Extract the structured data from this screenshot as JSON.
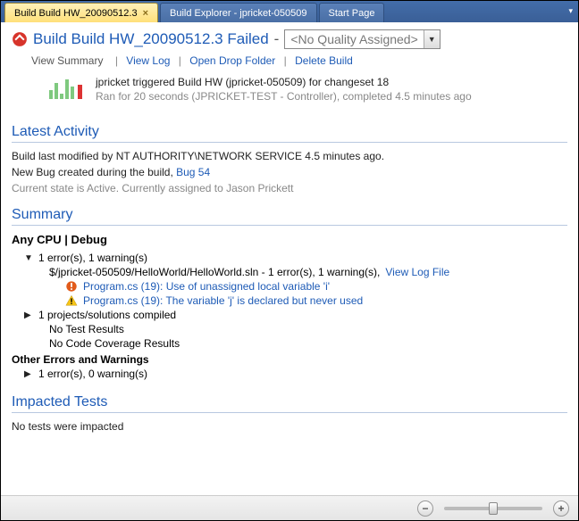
{
  "tabs": [
    {
      "label": "Build Build HW_20090512.3",
      "active": true
    },
    {
      "label": "Build Explorer - jpricket-050509",
      "active": false
    },
    {
      "label": "Start Page",
      "active": false
    }
  ],
  "header": {
    "title": "Build Build HW_20090512.3 Failed",
    "dash": " - ",
    "quality_placeholder": "<No Quality Assigned>"
  },
  "actions": {
    "view_summary": "View Summary",
    "view_log": "View Log",
    "open_drop": "Open Drop Folder",
    "delete_build": "Delete Build"
  },
  "trigger": {
    "line1": "jpricket triggered Build HW (jpricket-050509) for changeset 18",
    "line2": "Ran for 20 seconds (JPRICKET-TEST - Controller), completed 4.5 minutes ago"
  },
  "latest_activity": {
    "heading": "Latest Activity",
    "line1": "Build last modified by NT AUTHORITY\\NETWORK SERVICE 4.5 minutes ago.",
    "line2_pre": "New Bug created during the build, ",
    "bug_link": "Bug 54",
    "line3": "Current state is Active. Currently assigned to Jason Prickett"
  },
  "summary": {
    "heading": "Summary",
    "config": "Any CPU | Debug",
    "err_warn": "1 error(s), 1 warning(s)",
    "sln_path": "$/jpricket-050509/HelloWorld/HelloWorld.sln - 1 error(s), 1 warning(s), ",
    "view_log_file": "View Log File",
    "error_msg": "Program.cs (19): Use of unassigned local variable 'i'",
    "warn_msg": "Program.cs (19): The variable 'j' is declared but never used",
    "projects": "1 projects/solutions compiled",
    "no_tests": "No Test Results",
    "no_coverage": "No Code Coverage Results",
    "other_heading": "Other Errors and Warnings",
    "other_errwarn": "1 error(s), 0 warning(s)"
  },
  "impacted": {
    "heading": "Impacted Tests",
    "none": "No tests were impacted"
  }
}
